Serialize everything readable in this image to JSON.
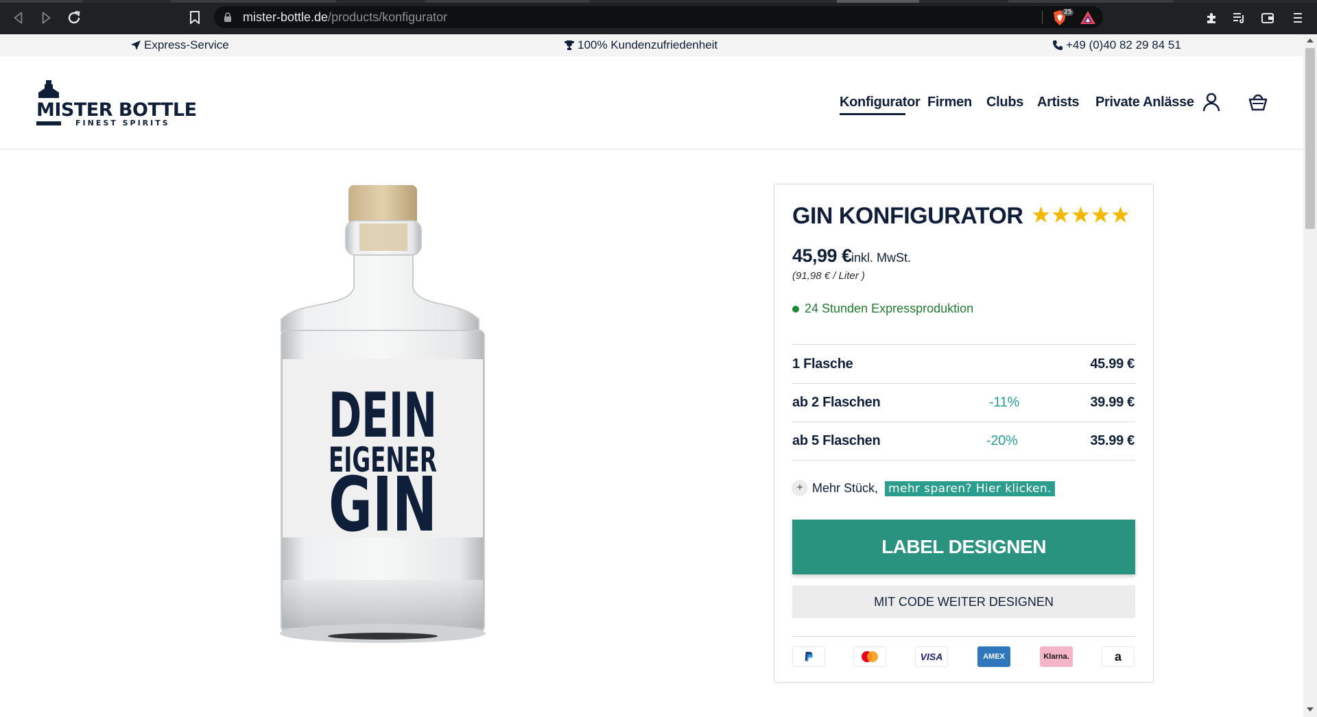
{
  "browser": {
    "url_domain": "mister-bottle.de",
    "url_path": "/products/konfigurator",
    "brave_badge": "25"
  },
  "info_bar": {
    "express": "Express-Service",
    "satisfaction": "100% Kundenzufriedenheit",
    "phone": "+49 (0)40 82 29 84 51"
  },
  "header": {
    "logo_title": "MISTER BOTTLE",
    "logo_sub": "FINEST SPIRITS",
    "nav": [
      "Konfigurator",
      "Firmen",
      "Clubs",
      "Artists",
      "Private Anlässe"
    ],
    "active_nav": "Konfigurator"
  },
  "product": {
    "label_line1": "DEIN",
    "label_line2": "EIGENER",
    "label_line3": "GIN"
  },
  "config": {
    "title": "GIN KONFIGURATOR",
    "rating": 5,
    "price": "45,99 €",
    "price_note": "inkl. MwSt.",
    "per_liter": "(91,98 € / Liter )",
    "express": "24 Stunden Expressproduktion",
    "tiers": [
      {
        "qty": "1  Flasche",
        "discount": "",
        "price": "45.99 €"
      },
      {
        "qty": "ab 2 Flaschen",
        "discount": "-11%",
        "price": "39.99 €"
      },
      {
        "qty": "ab 5 Flaschen",
        "discount": "-20%",
        "price": "35.99 €"
      }
    ],
    "more_text": "Mehr Stück,",
    "more_link": "mehr sparen? Hier klicken.",
    "primary_button": "LABEL DESIGNEN",
    "secondary_button": "MIT CODE WEITER DESIGNEN",
    "payments": [
      "PayPal",
      "Mastercard",
      "VISA",
      "AMEX",
      "Klarna.",
      "a"
    ]
  },
  "colors": {
    "brand_navy": "#0f1f3a",
    "accent_teal": "#2a9380",
    "star": "#f5b800",
    "express_green": "#1f8a36"
  }
}
